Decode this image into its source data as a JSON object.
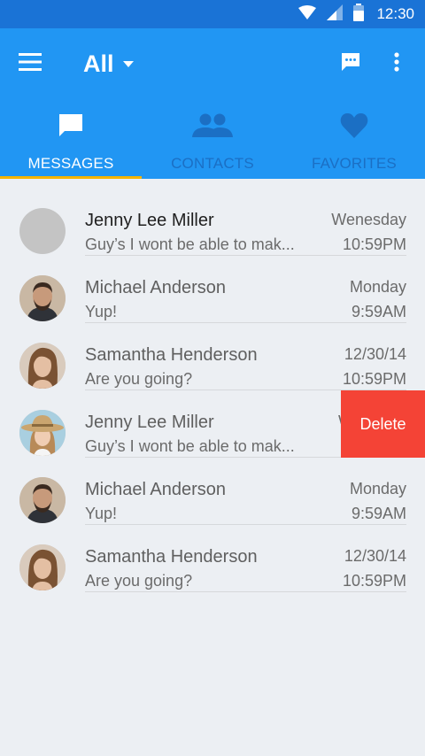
{
  "status_bar": {
    "time": "12:30"
  },
  "toolbar": {
    "filter_label": "All"
  },
  "tabs": [
    {
      "label": "MESSAGES",
      "icon": "chat-bubble-icon",
      "active": true
    },
    {
      "label": "CONTACTS",
      "icon": "people-icon",
      "active": false
    },
    {
      "label": "FAVORITES",
      "icon": "heart-icon",
      "active": false
    }
  ],
  "conversations": [
    {
      "name": "Jenny Lee Miller",
      "snippet": "Guy’s I wont be able to mak...",
      "date": "Wenesday",
      "time": "10:59PM",
      "avatar": "placeholder",
      "unread": true
    },
    {
      "name": "Michael Anderson",
      "snippet": "Yup!",
      "date": "Monday",
      "time": "9:59AM",
      "avatar": "man-photo",
      "unread": false
    },
    {
      "name": "Samantha Henderson",
      "snippet": "Are you going?",
      "date": "12/30/14",
      "time": "10:59PM",
      "avatar": "woman-photo",
      "unread": false
    },
    {
      "name": "Jenny Lee Miller",
      "snippet": "Guy’s I wont be able to mak...",
      "date": "W",
      "time": "",
      "avatar": "woman-hat-photo",
      "unread": false
    },
    {
      "name": "Michael Anderson",
      "snippet": "Yup!",
      "date": "Monday",
      "time": "9:59AM",
      "avatar": "man-photo",
      "unread": false
    },
    {
      "name": "Samantha Henderson",
      "snippet": "Are you going?",
      "date": "12/30/14",
      "time": "10:59PM",
      "avatar": "woman-photo",
      "unread": false
    }
  ],
  "swipe_action": {
    "label": "Delete"
  },
  "colors": {
    "status_bar": "#1a73d6",
    "toolbar": "#2196f3",
    "tab_indicator": "#f5b400",
    "delete": "#f44336",
    "background": "#eceff3"
  }
}
